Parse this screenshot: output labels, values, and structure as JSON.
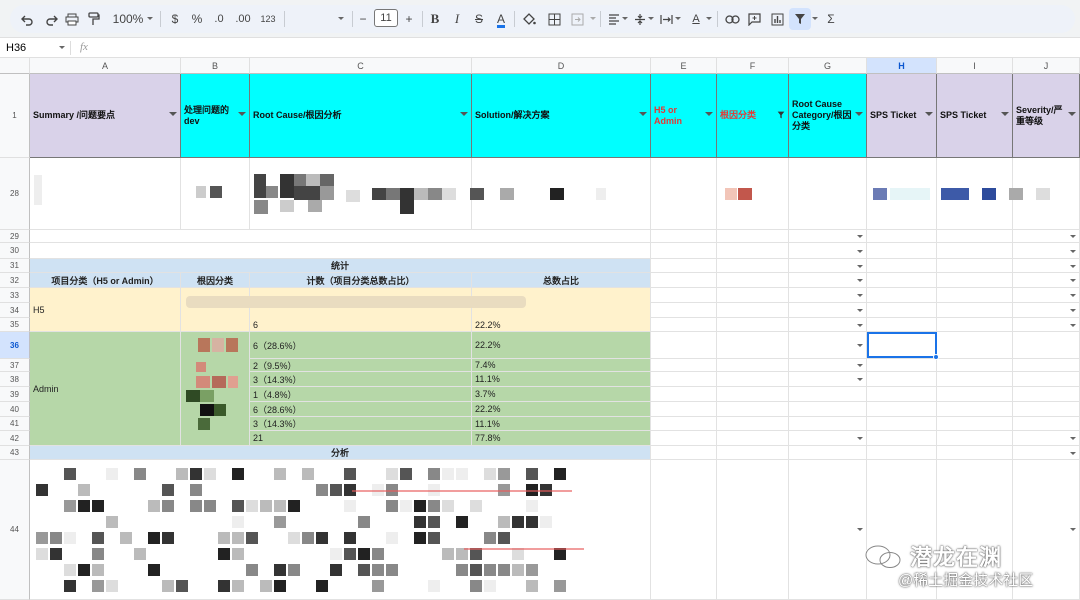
{
  "toolbar": {
    "zoom": "100%",
    "currency": "$",
    "percent": "%",
    "dec_decrease": ".0",
    "dec_increase": ".00",
    "number_format": "123",
    "font_size": "11",
    "minus": "−",
    "plus": "+",
    "bold": "B",
    "italic": "I",
    "strike": "S",
    "text_color": "A",
    "sum": "Σ"
  },
  "formula_bar": {
    "cell_ref": "H36",
    "fx": "fx"
  },
  "columns": [
    "A",
    "B",
    "C",
    "D",
    "E",
    "F",
    "G",
    "H",
    "I",
    "J"
  ],
  "selected_column": "H",
  "header_row": {
    "row_num": "1",
    "a": "Summary /问题要点",
    "b": "处理问题的dev",
    "c": "Root Cause/根因分析",
    "d": "Solution/解决方案",
    "e": "H5 or Admin",
    "f": "根因分类",
    "g": "Root Cause Category/根因分类",
    "h": "SPS Ticket",
    "i": "SPS Ticket",
    "j": "Severity/严重等级"
  },
  "rows": {
    "r28": "28",
    "r29": "29",
    "r30": "30",
    "r31": "31",
    "r32": "32",
    "r33": "33",
    "r34": "34",
    "r35": "35",
    "r36": "36",
    "r37": "37",
    "r38": "38",
    "r39": "39",
    "r40": "40",
    "r41": "41",
    "r42": "42",
    "r43": "43",
    "r44": "44"
  },
  "stats": {
    "title": "统计",
    "col_project": "项目分类（H5 or Admin）",
    "col_root": "根因分类",
    "col_count": "计数（项目分类总数占比）",
    "col_total": "总数占比",
    "h5_label": "H5",
    "h5_count": "6",
    "h5_total": "22.2%",
    "admin_label": "Admin",
    "admin_rows": [
      {
        "count": "6（28.6%）",
        "total": "22.2%"
      },
      {
        "count": "2（9.5%）",
        "total": "7.4%"
      },
      {
        "count": "3（14.3%）",
        "total": "11.1%"
      },
      {
        "count": "1（4.8%）",
        "total": "3.7%"
      },
      {
        "count": "6（28.6%）",
        "total": "22.2%"
      },
      {
        "count": "3（14.3%）",
        "total": "11.1%"
      },
      {
        "count": "21",
        "total": "77.8%"
      }
    ],
    "analysis": "分析"
  },
  "watermark": {
    "line1": "潜龙在渊",
    "line2": "@稀土掘金技术社区"
  },
  "colors": {
    "lavender": "#d9d2e9",
    "cyan": "#00ffff",
    "stat_blue": "#cfe2f3",
    "h5_yellow": "#fff2cc",
    "admin_green": "#b6d7a8",
    "red_text": "#e53935",
    "selection": "#1a73e8"
  }
}
